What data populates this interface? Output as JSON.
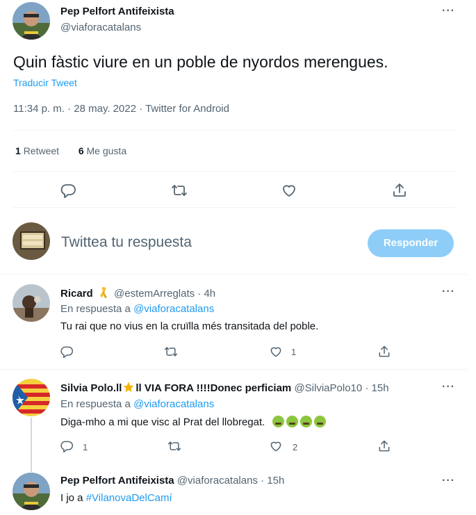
{
  "tweet": {
    "author_name": "Pep Pelfort Antifeixista",
    "author_handle": "@viaforacatalans",
    "text": "Quin fàstic viure en un poble de nyordos merengues.",
    "translate_label": "Traducir Tweet",
    "meta": "11:34 p. m. · 28 may. 2022 · Twitter for Android",
    "retweets_count": "1",
    "retweets_label": "Retweet",
    "likes_count": "6",
    "likes_label": "Me gusta"
  },
  "compose": {
    "placeholder": "Twittea tu respuesta",
    "reply_button": "Responder"
  },
  "replies": [
    {
      "name": "Ricard",
      "handle_time": "@estemArreglats · 4h",
      "reply_to_prefix": "En respuesta a",
      "reply_to_handle": "@viaforacatalans",
      "text": "Tu rai que no vius en la cruïlla més transitada del poble.",
      "like_count": "1"
    },
    {
      "name_part1": "Silvia Polo.ll",
      "name_part2": "ll VIA FORA !!!!Donec perficiam",
      "handle_time": "@SilviaPolo10 · 15h",
      "reply_to_prefix": "En respuesta a",
      "reply_to_handle": "@viaforacatalans",
      "text": "Diga-mho a mi que visc al Prat del llobregat.",
      "reply_count": "1",
      "like_count": "2"
    },
    {
      "name": "Pep Pelfort Antifeixista",
      "handle_time": "@viaforacatalans · 15h",
      "text_prefix": "I jo a",
      "hashtag": "#VilanovaDelCamí"
    }
  ],
  "colors": {
    "accent": "#1d9bf0",
    "secondary_text": "#536471",
    "divider": "#eff3f4",
    "reply_button_disabled": "#8ecdf8"
  }
}
